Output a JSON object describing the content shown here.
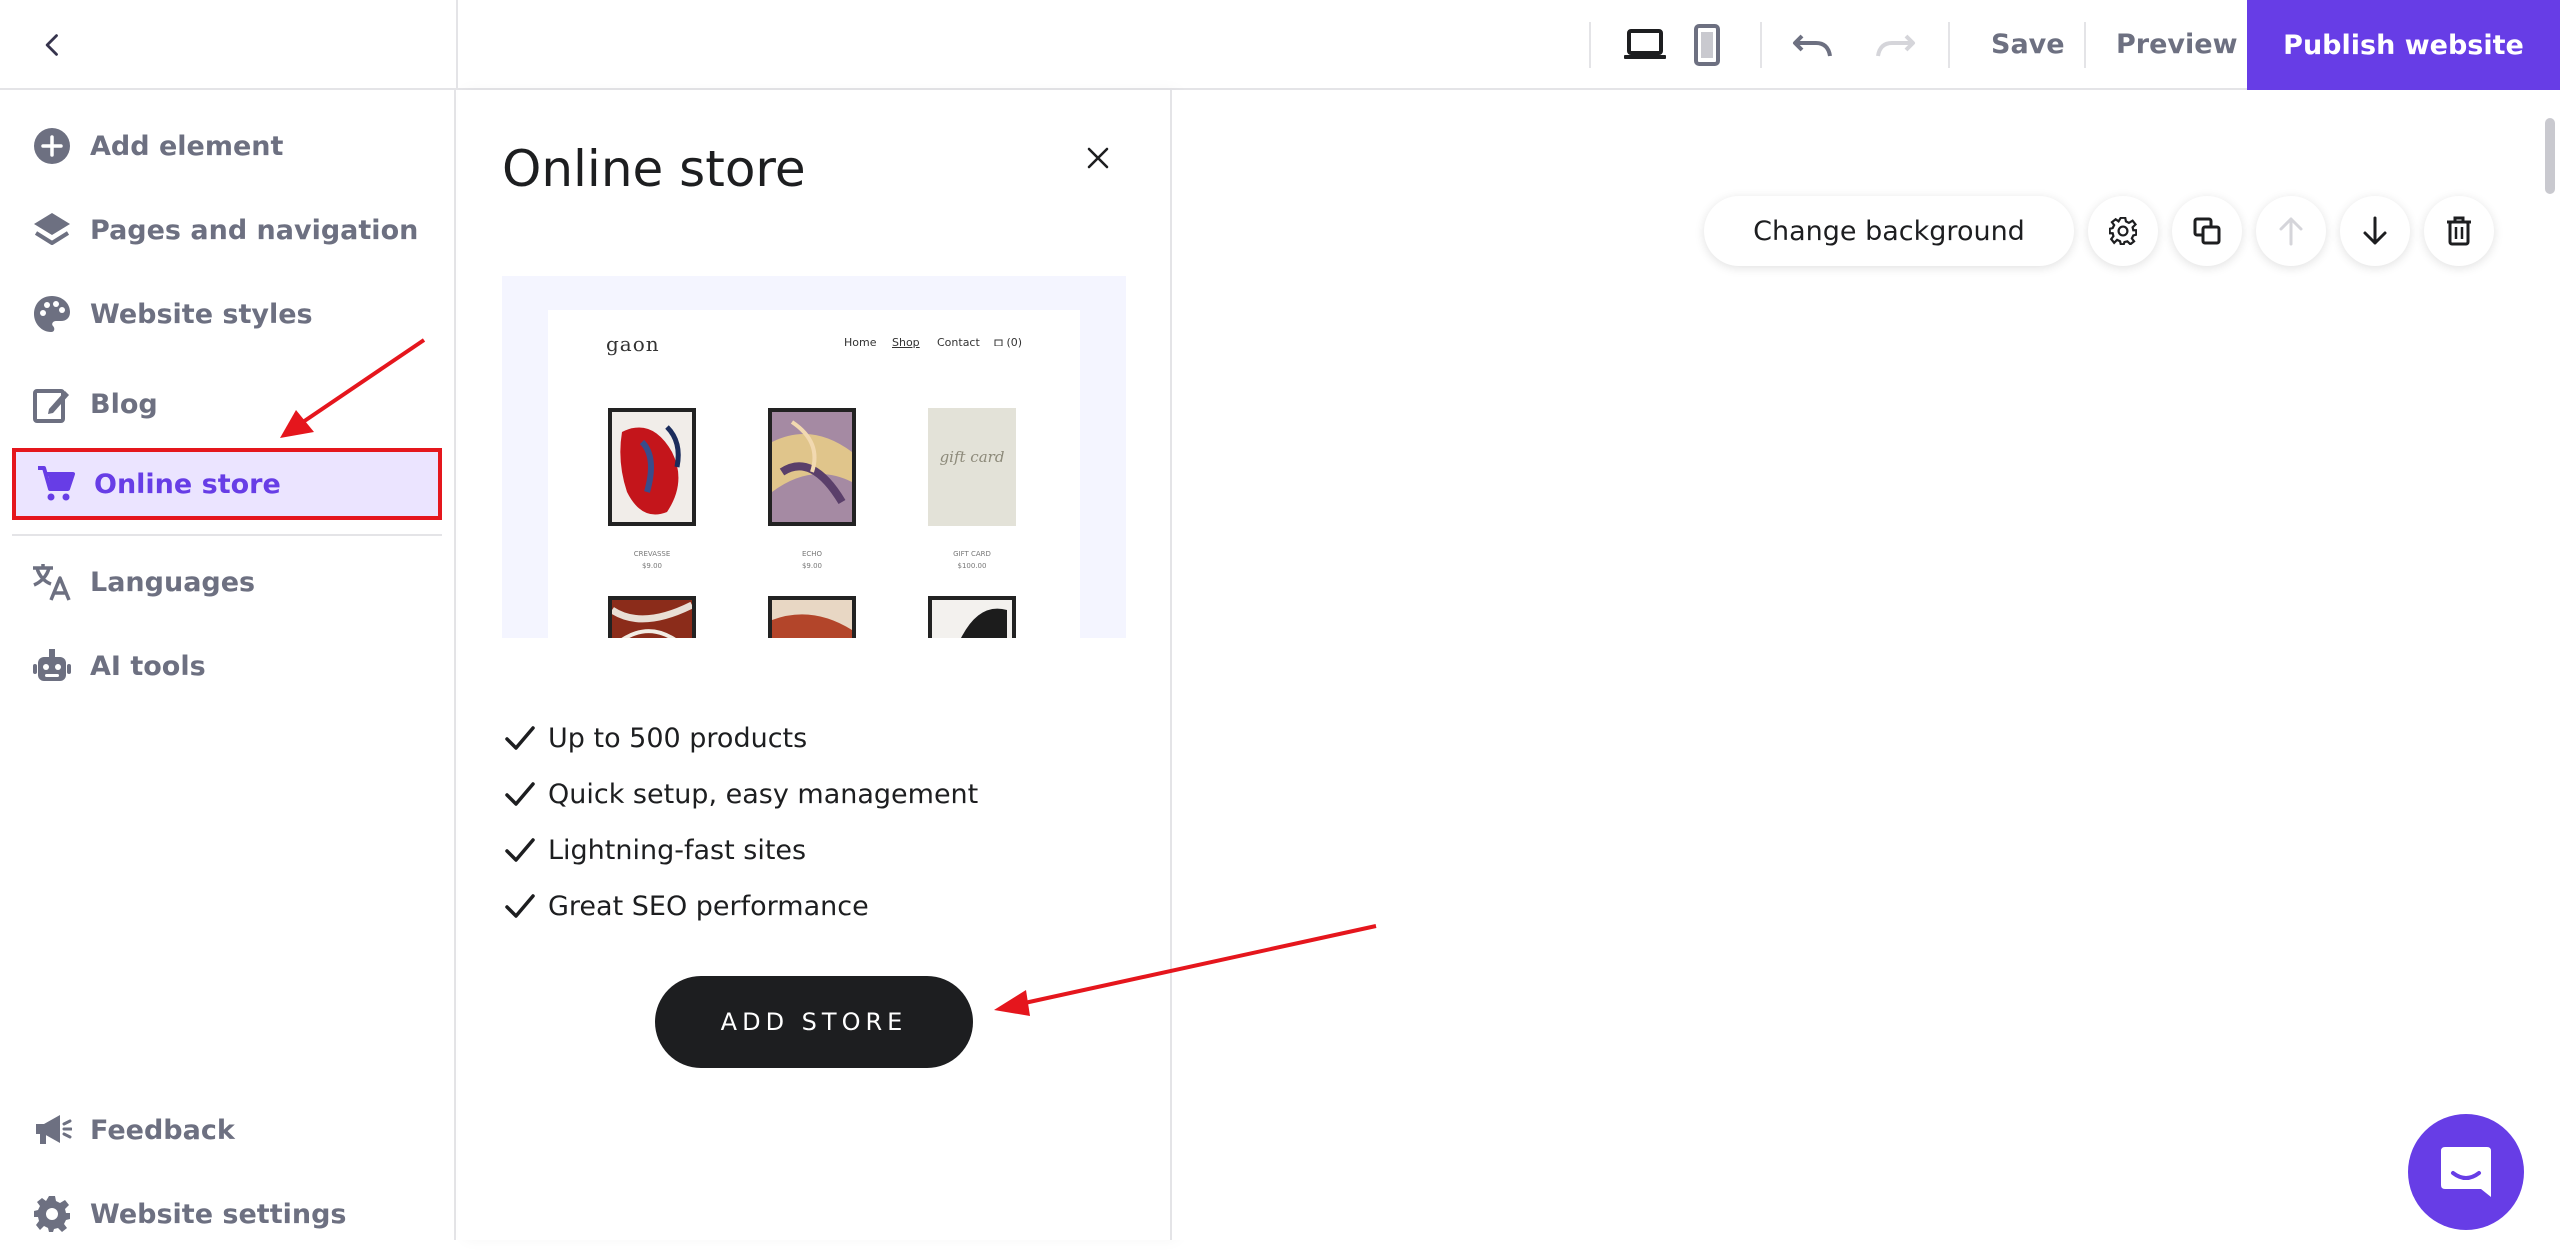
{
  "topbar": {
    "save_label": "Save",
    "preview_label": "Preview",
    "publish_label": "Publish website",
    "icons": [
      "back-arrow-icon",
      "desktop-icon",
      "mobile-icon",
      "undo-icon",
      "redo-icon"
    ]
  },
  "sidebar": {
    "items": [
      {
        "label": "Add element",
        "icon": "plus-circle-icon"
      },
      {
        "label": "Pages and navigation",
        "icon": "layers-icon"
      },
      {
        "label": "Website styles",
        "icon": "palette-icon"
      },
      {
        "label": "Blog",
        "icon": "edit-icon"
      },
      {
        "label": "Online store",
        "icon": "cart-icon",
        "active": true
      },
      {
        "label": "Languages",
        "icon": "translate-icon"
      },
      {
        "label": "AI tools",
        "icon": "robot-icon"
      }
    ],
    "bottom_items": [
      {
        "label": "Feedback",
        "icon": "megaphone-icon"
      },
      {
        "label": "Website settings",
        "icon": "gear-icon"
      }
    ]
  },
  "panel": {
    "title": "Online store",
    "preview": {
      "logo": "gaon",
      "nav": [
        "Home",
        "Shop",
        "Contact",
        "(0)"
      ],
      "products": [
        {
          "name": "CREVASSE",
          "price": "$9.00"
        },
        {
          "name": "ECHO",
          "price": "$9.00"
        },
        {
          "name": "GIFT CARD",
          "price": "$100.00"
        }
      ],
      "gift_card_text": "gift card"
    },
    "features": [
      "Up to 500 products",
      "Quick setup, easy management",
      "Lightning-fast sites",
      "Great SEO performance"
    ],
    "cta": "ADD STORE"
  },
  "canvas": {
    "change_background": "Change background"
  },
  "colors": {
    "accent": "#673de6",
    "active_bg": "#ebe4ff",
    "highlight": "#e5161d",
    "dark_button": "#1d1e20",
    "muted_text": "#6d7081"
  }
}
